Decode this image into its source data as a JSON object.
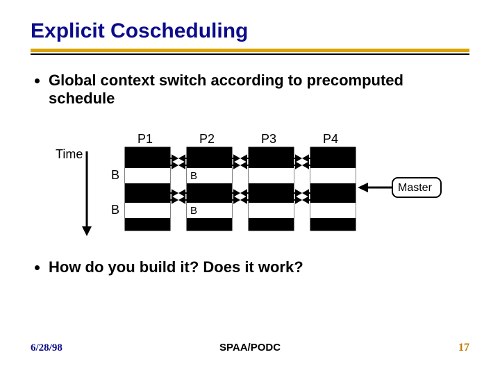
{
  "title": "Explicit Coscheduling",
  "bullets": [
    "Global context switch according to precomputed schedule",
    "How do you build it? Does it work?"
  ],
  "diagram": {
    "time_label": "Time",
    "processors": [
      "P1",
      "P2",
      "P3",
      "P4"
    ],
    "row_labels": [
      "B",
      "B"
    ],
    "master_label": "Master"
  },
  "footer": {
    "date": "6/28/98",
    "venue": "SPAA/PODC",
    "page": "17"
  }
}
